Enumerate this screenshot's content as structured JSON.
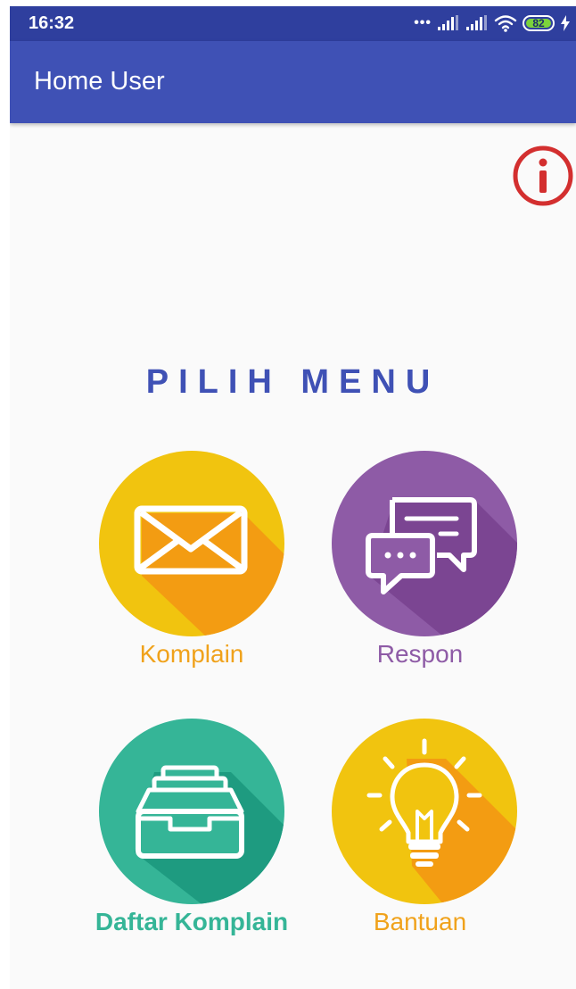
{
  "status_bar": {
    "time": "16:32",
    "signal_dots": "•••",
    "battery_level": "82"
  },
  "app_bar": {
    "title": "Home User"
  },
  "info_button": {
    "icon": "info-icon",
    "color": "#d32f2f"
  },
  "main": {
    "heading": "PILIH MENU",
    "menu": [
      {
        "label": "Komplain",
        "icon": "envelope-icon",
        "color": "#f1c40f",
        "shadow": "#f39c12",
        "label_color": "#f0a21b"
      },
      {
        "label": "Respon",
        "icon": "chat-bubbles-icon",
        "color": "#8e5ba6",
        "shadow": "#7b4592",
        "label_color": "#8e5ba6"
      },
      {
        "label": "Daftar Komplain",
        "icon": "inbox-tray-icon",
        "color": "#35b597",
        "shadow": "#1e9b80",
        "label_color": "#35b597"
      },
      {
        "label": "Bantuan",
        "icon": "lightbulb-icon",
        "color": "#f1c40f",
        "shadow": "#f39c12",
        "label_color": "#f0a21b"
      }
    ]
  },
  "colors": {
    "primary": "#3f51b5",
    "primary_dark": "#2f3f9e",
    "background": "#fafafa"
  }
}
